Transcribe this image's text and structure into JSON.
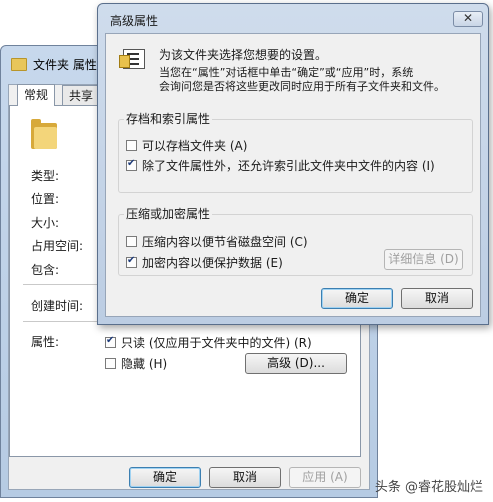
{
  "back_window": {
    "title": "文件夹 属性",
    "tabs": [
      {
        "label": "常规"
      },
      {
        "label": "共享"
      }
    ],
    "props": {
      "type": "类型:",
      "location": "位置:",
      "size": "大小:",
      "size_on_disk": "占用空间:",
      "contains": "包含:",
      "created": "创建时间:",
      "attributes": "属性:"
    },
    "readonly_label": "只读 (仅应用于文件夹中的文件) (R)",
    "hidden_label": "隐藏 (H)",
    "advanced_button": "高级 (D)...",
    "ok_button": "确定",
    "cancel_button": "取消",
    "apply_button": "应用 (A)"
  },
  "front_window": {
    "title": "高级属性",
    "close_glyph": "✕",
    "intro_line1": "为该文件夹选择您想要的设置。",
    "intro_line2": "当您在“属性”对话框中单击“确定”或“应用”时，系统",
    "intro_line3": "会询问您是否将这些更改同时应用于所有子文件夹和文件。",
    "archive_group": {
      "title": "存档和索引属性",
      "archive_label": "可以存档文件夹 (A)",
      "archive_checked": false,
      "index_label": "除了文件属性外，还允许索引此文件夹中文件的内容 (I)",
      "index_checked": true
    },
    "compress_group": {
      "title": "压缩或加密属性",
      "compress_label": "压缩内容以便节省磁盘空间 (C)",
      "compress_checked": false,
      "encrypt_label": "加密内容以便保护数据 (E)",
      "encrypt_checked": true,
      "details_button": "详细信息 (D)"
    },
    "ok_button": "确定",
    "cancel_button": "取消"
  },
  "watermark": "头条 @睿花股灿烂",
  "icons": [
    "folder-icon",
    "close-icon",
    "attributes-info-icon"
  ],
  "colors": {
    "title_bar": "#c7d8ec",
    "dialog_bg": "#f0f0f0",
    "default_button_border": "#3c7fb1"
  }
}
